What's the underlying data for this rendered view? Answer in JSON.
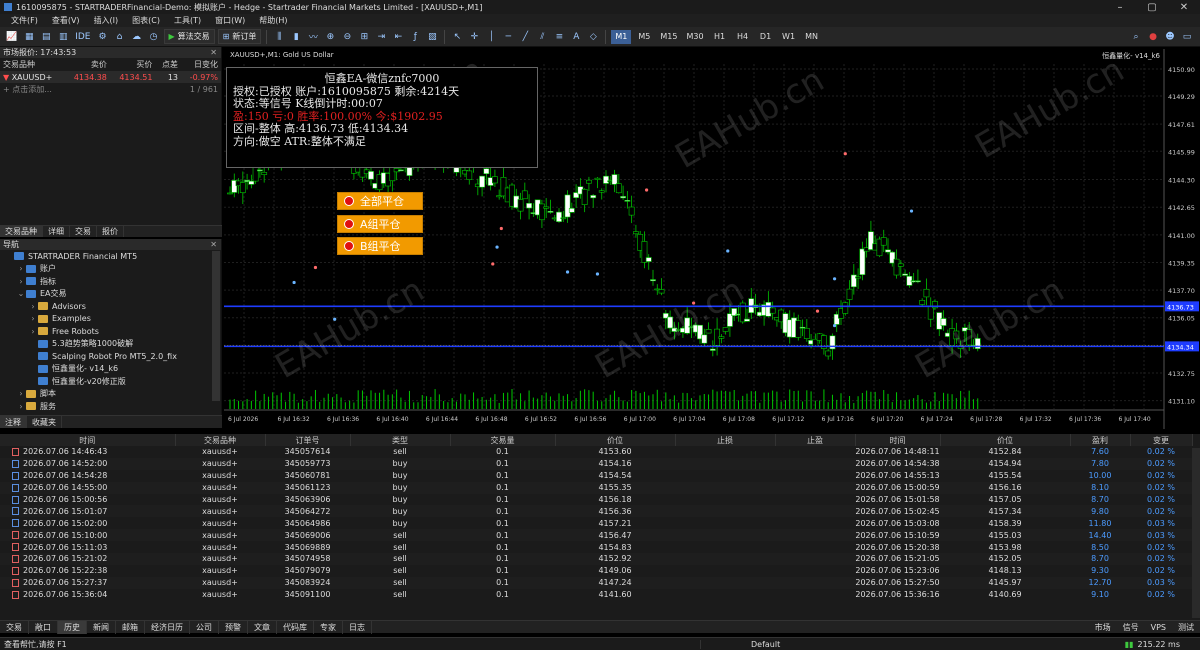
{
  "window": {
    "title": "1610095875 - STARTRADERFinancial-Demo: 模拟账户 - Hedge - Startrader Financial Markets Limited - [XAUUSD+,M1]"
  },
  "menu": [
    "文件(F)",
    "查看(V)",
    "插入(I)",
    "图表(C)",
    "工具(T)",
    "窗口(W)",
    "帮助(H)"
  ],
  "toolbar": {
    "ide": "IDE",
    "algo": "算法交易",
    "new_order": "新订单",
    "timeframes": [
      "M1",
      "M5",
      "M15",
      "M30",
      "H1",
      "H4",
      "D1",
      "W1",
      "MN"
    ],
    "active_tf": "M1"
  },
  "market_watch": {
    "title": "市场报价: 17:43:53",
    "columns": [
      "交易品种",
      "卖价",
      "买价",
      "点差",
      "日变化"
    ],
    "rows": [
      {
        "symbol": "XAUUSD+",
        "bid": "4134.38",
        "ask": "4134.51",
        "spread": "13",
        "change": "-0.97%"
      }
    ],
    "add_label": "点击添加...",
    "count": "1 / 961",
    "tabs": [
      "交易品种",
      "详细",
      "交易",
      "报价"
    ]
  },
  "navigator": {
    "title": "导航",
    "items": [
      {
        "label": "STARTRADER Financial MT5",
        "level": 0,
        "arrow": "",
        "icon": "robot"
      },
      {
        "label": "账户",
        "level": 1,
        "arrow": "›",
        "icon": "robot"
      },
      {
        "label": "指标",
        "level": 1,
        "arrow": "›",
        "icon": "robot"
      },
      {
        "label": "EA交易",
        "level": 1,
        "arrow": "⌄",
        "icon": "robot"
      },
      {
        "label": "Advisors",
        "level": 2,
        "arrow": "›",
        "icon": "folder"
      },
      {
        "label": "Examples",
        "level": 2,
        "arrow": "›",
        "icon": "folder"
      },
      {
        "label": "Free Robots",
        "level": 2,
        "arrow": "›",
        "icon": "folder"
      },
      {
        "label": "5.3趋势策略1000破解",
        "level": 2,
        "arrow": "",
        "icon": "robot"
      },
      {
        "label": "Scalping Robot Pro MT5_2.0_fix",
        "level": 2,
        "arrow": "",
        "icon": "robot"
      },
      {
        "label": "恒鑫量化- v14_k6",
        "level": 2,
        "arrow": "",
        "icon": "robot"
      },
      {
        "label": "恒鑫量化-v20修正版",
        "level": 2,
        "arrow": "",
        "icon": "robot"
      },
      {
        "label": "脚本",
        "level": 1,
        "arrow": "›",
        "icon": "folder"
      },
      {
        "label": "服务",
        "level": 1,
        "arrow": "›",
        "icon": "folder"
      }
    ],
    "tabs": [
      "注释",
      "收藏夹"
    ]
  },
  "chart": {
    "symbol_label": "XAUUSD+,M1: Gold US Dollar",
    "ea_label": "恒鑫量化- v14_k6",
    "info": {
      "title": "恒鑫EA-微信znfc7000",
      "line1": "授权:已授权 账户:1610095875 剩余:4214天",
      "line2": "状态:等信号  K线倒计时:00:07",
      "line3": "盈:150  亏:0   胜率:100.00% 今:$1902.95",
      "line4": "区间-整体 高:4136.73 低:4134.34",
      "line5": "方向:做空 ATR:整体不满足"
    },
    "buttons": [
      "全部平仓",
      "A组平仓",
      "B组平仓"
    ],
    "price_labels": [
      "4150.90",
      "4149.29",
      "4147.61",
      "4145.99",
      "4144.30",
      "4142.65",
      "4141.00",
      "4139.35",
      "4137.70",
      "4136.05",
      "4134.40",
      "4132.75",
      "4131.10"
    ],
    "hline_labels": [
      "4136.73",
      "4134.34"
    ],
    "time_labels": [
      "6 Jul 2026",
      "6 Jul 16:32",
      "6 Jul 16:36",
      "6 Jul 16:40",
      "6 Jul 16:44",
      "6 Jul 16:48",
      "6 Jul 16:52",
      "6 Jul 16:56",
      "6 Jul 17:00",
      "6 Jul 17:04",
      "6 Jul 17:08",
      "6 Jul 17:12",
      "6 Jul 17:16",
      "6 Jul 17:20",
      "6 Jul 17:24",
      "6 Jul 17:28",
      "6 Jul 17:32",
      "6 Jul 17:36",
      "6 Jul 17:40"
    ],
    "colors": {
      "bull": "#ffffff",
      "bear": "#000000",
      "wick": "#00c800",
      "hline": "#1e3cff",
      "volume": "#00c800"
    }
  },
  "trade": {
    "columns": [
      "时间",
      "交易品种",
      "订单号",
      "类型",
      "交易量",
      "价位",
      "止损",
      "止盈",
      "时间",
      "价位",
      "盈利",
      "变更"
    ],
    "rows": [
      [
        "2026.07.06 14:46:43",
        "xauusd+",
        "345057614",
        "sell",
        "0.1",
        "4153.60",
        "",
        "",
        "2026.07.06 14:48:11",
        "4152.84",
        "7.60",
        "0.02 %"
      ],
      [
        "2026.07.06 14:52:00",
        "xauusd+",
        "345059773",
        "buy",
        "0.1",
        "4154.16",
        "",
        "",
        "2026.07.06 14:54:38",
        "4154.94",
        "7.80",
        "0.02 %"
      ],
      [
        "2026.07.06 14:54:28",
        "xauusd+",
        "345060781",
        "buy",
        "0.1",
        "4154.54",
        "",
        "",
        "2026.07.06 14:55:13",
        "4155.54",
        "10.00",
        "0.02 %"
      ],
      [
        "2026.07.06 14:55:00",
        "xauusd+",
        "345061123",
        "buy",
        "0.1",
        "4155.35",
        "",
        "",
        "2026.07.06 15:00:59",
        "4156.16",
        "8.10",
        "0.02 %"
      ],
      [
        "2026.07.06 15:00:56",
        "xauusd+",
        "345063906",
        "buy",
        "0.1",
        "4156.18",
        "",
        "",
        "2026.07.06 15:01:58",
        "4157.05",
        "8.70",
        "0.02 %"
      ],
      [
        "2026.07.06 15:01:07",
        "xauusd+",
        "345064272",
        "buy",
        "0.1",
        "4156.36",
        "",
        "",
        "2026.07.06 15:02:45",
        "4157.34",
        "9.80",
        "0.02 %"
      ],
      [
        "2026.07.06 15:02:00",
        "xauusd+",
        "345064986",
        "buy",
        "0.1",
        "4157.21",
        "",
        "",
        "2026.07.06 15:03:08",
        "4158.39",
        "11.80",
        "0.03 %"
      ],
      [
        "2026.07.06 15:10:00",
        "xauusd+",
        "345069006",
        "sell",
        "0.1",
        "4156.47",
        "",
        "",
        "2026.07.06 15:10:59",
        "4155.03",
        "14.40",
        "0.03 %"
      ],
      [
        "2026.07.06 15:11:03",
        "xauusd+",
        "345069889",
        "sell",
        "0.1",
        "4154.83",
        "",
        "",
        "2026.07.06 15:20:38",
        "4153.98",
        "8.50",
        "0.02 %"
      ],
      [
        "2026.07.06 15:21:02",
        "xauusd+",
        "345074958",
        "sell",
        "0.1",
        "4152.92",
        "",
        "",
        "2026.07.06 15:21:05",
        "4152.05",
        "8.70",
        "0.02 %"
      ],
      [
        "2026.07.06 15:22:38",
        "xauusd+",
        "345079079",
        "sell",
        "0.1",
        "4149.06",
        "",
        "",
        "2026.07.06 15:23:06",
        "4148.13",
        "9.30",
        "0.02 %"
      ],
      [
        "2026.07.06 15:27:37",
        "xauusd+",
        "345083924",
        "sell",
        "0.1",
        "4147.24",
        "",
        "",
        "2026.07.06 15:27:50",
        "4145.97",
        "12.70",
        "0.03 %"
      ],
      [
        "2026.07.06 15:36:04",
        "xauusd+",
        "345091100",
        "sell",
        "0.1",
        "4141.60",
        "",
        "",
        "2026.07.06 15:36:16",
        "4140.69",
        "9.10",
        "0.02 %"
      ]
    ]
  },
  "bottom_tabs": [
    "交易",
    "敞口",
    "历史",
    "新闻",
    "邮箱",
    "经济日历",
    "公司",
    "预警",
    "文章",
    "代码库",
    "专家",
    "日志"
  ],
  "bottom_right": [
    "市场",
    "信号",
    "VPS",
    "测试"
  ],
  "status": {
    "help": "查看帮忙,请按 F1",
    "profile": "Default",
    "ping": "215.22 ms"
  },
  "watermark": "EAHub.cn"
}
